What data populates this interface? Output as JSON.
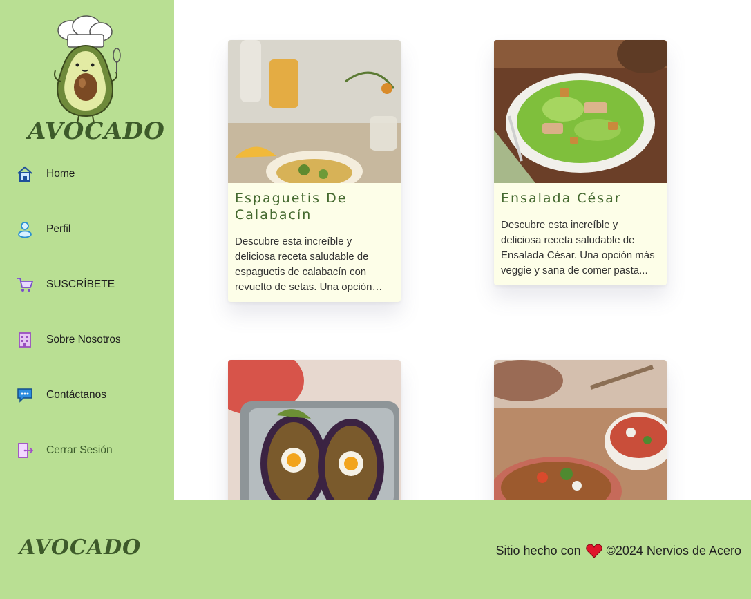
{
  "sidebar": {
    "logo_text": "AVOCADO",
    "items": [
      {
        "label": "Home",
        "icon": "home-icon"
      },
      {
        "label": "Perfil",
        "icon": "user-icon"
      },
      {
        "label": "SUSCRÍBETE",
        "icon": "cart-icon"
      },
      {
        "label": "Sobre Nosotros",
        "icon": "building-icon"
      },
      {
        "label": "Contáctanos",
        "icon": "chat-icon"
      },
      {
        "label": "Cerrar Sesión",
        "icon": "logout-icon"
      }
    ]
  },
  "recipes": [
    {
      "title": "Espaguetis De Calabacín",
      "description": "Descubre esta increíble y deliciosa receta saludable de espaguetis de calabacín con revuelto de setas. Una opción más veggie y sana de comer pasta...",
      "image": "zucchini-spaghetti-photo"
    },
    {
      "title": "Ensalada César",
      "description": "Descubre esta increíble y deliciosa receta saludable de Ensalada César. Una opción más veggie y sana de comer pasta...",
      "image": "caesar-salad-photo"
    },
    {
      "title": "",
      "description": "",
      "image": "stuffed-eggplant-photo"
    },
    {
      "title": "",
      "description": "",
      "image": "quinoa-salad-photo"
    }
  ],
  "footer": {
    "logo_text": "AVOCADO",
    "credit_prefix": "Sitio hecho con",
    "credit_suffix": "©2024 Nervios de Acero"
  },
  "colors": {
    "sidebar_bg": "#b9df93",
    "card_bg": "#fdfee8",
    "title_green": "#44692f",
    "logo_green": "#3d5a2a"
  }
}
